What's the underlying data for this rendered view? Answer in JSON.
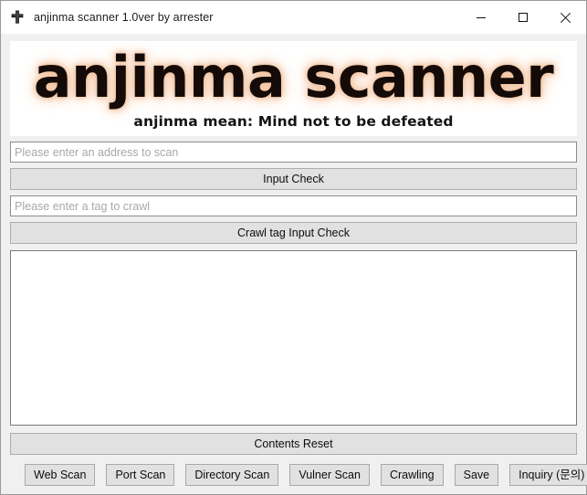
{
  "window": {
    "title": "anjinma scanner 1.0ver by arrester",
    "icon": "app-cross-icon",
    "controls": {
      "minimize": "minimize-icon",
      "maximize": "maximize-icon",
      "close": "close-icon"
    }
  },
  "banner": {
    "logo_text": "anjinma scanner",
    "subtitle": "anjinma mean: Mind not to be defeated",
    "glow_color": "#f0b98f",
    "text_color": "#140b08",
    "background": "#ffffff"
  },
  "form": {
    "address_placeholder": "Please enter an address to scan",
    "address_value": "",
    "input_check_label": "Input Check",
    "tag_placeholder": "Please enter a tag to crawl",
    "tag_value": "",
    "crawl_check_label": "Crawl tag Input Check"
  },
  "console": {
    "value": "",
    "placeholder": ""
  },
  "reset": {
    "label": "Contents Reset"
  },
  "actions": [
    {
      "label": "Web Scan",
      "name": "web-scan-button"
    },
    {
      "label": "Port Scan",
      "name": "port-scan-button"
    },
    {
      "label": "Directory Scan",
      "name": "directory-scan-button"
    },
    {
      "label": "Vulner Scan",
      "name": "vulner-scan-button"
    },
    {
      "label": "Crawling",
      "name": "crawling-button"
    },
    {
      "label": "Save",
      "name": "save-button"
    },
    {
      "label": "Inquiry (문의)",
      "name": "inquiry-button"
    }
  ],
  "theme": {
    "window_background": "#f0f0f0",
    "button_face": "#e1e1e1",
    "button_border": "#adadad",
    "field_background": "#ffffff",
    "field_border": "#8d8d8d",
    "text_color": "#0d0d0d"
  }
}
